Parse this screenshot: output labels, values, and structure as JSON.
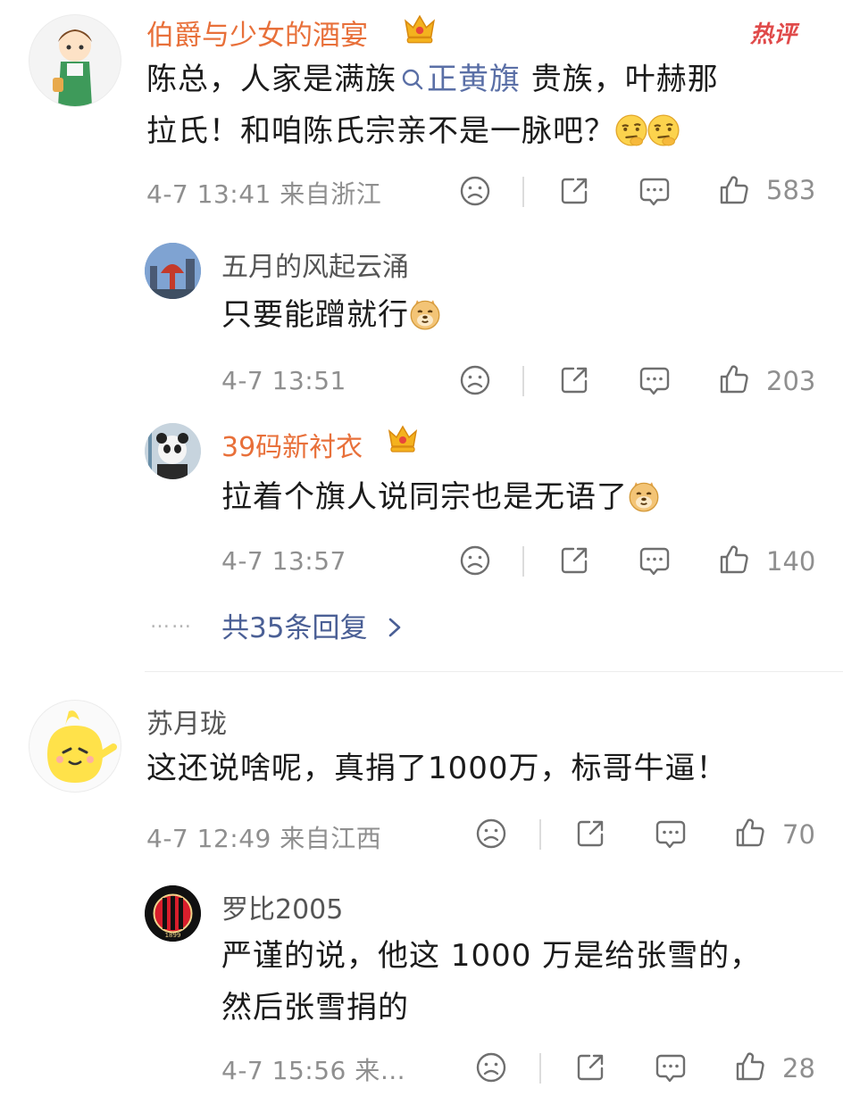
{
  "hot_badge": "热评",
  "comments": [
    {
      "user": "伯爵与少女的酒宴",
      "text_before": "陈总，人家是满族",
      "topic": "正黄旗",
      "text_after": " 贵族，叶赫那",
      "text_line2": "拉氏！和咱陈氏宗亲不是一脉吧？",
      "meta": "4-7 13:41 来自浙江",
      "likes": "583",
      "replies": [
        {
          "user": "五月的风起云涌",
          "text": "只要能蹭就行",
          "meta": "4-7 13:51",
          "likes": "203"
        },
        {
          "user": "39码新衬衣",
          "text": "拉着个旗人说同宗也是无语了",
          "meta": "4-7 13:57",
          "likes": "140"
        }
      ],
      "more_dots": "……",
      "more_replies": "共35条回复"
    },
    {
      "user": "苏月珑",
      "text": "这还说啥呢，真捐了1000万，标哥牛逼！",
      "meta": "4-7 12:49 来自江西",
      "likes": "70",
      "replies": [
        {
          "user": "罗比2005",
          "text_line1": "严谨的说，他这 1000 万是给张雪的，",
          "text_line2": "然后张雪捐的",
          "meta": "4-7 15:56 来…",
          "likes": "28"
        }
      ]
    }
  ],
  "icons": {
    "dislike": "sad-face-icon",
    "share": "share-icon",
    "comment": "comment-icon",
    "like": "thumbs-up-icon",
    "crown": "crown-badge-icon",
    "emoji_think": "thinking-emoji-icon",
    "emoji_doge": "doge-emoji-icon",
    "search": "search-icon"
  },
  "colors": {
    "username_highlight": "#e8703a",
    "topic_link": "#5a6fa6",
    "meta_gray": "#8f8f8f",
    "hot_badge": "#e04a4a"
  }
}
